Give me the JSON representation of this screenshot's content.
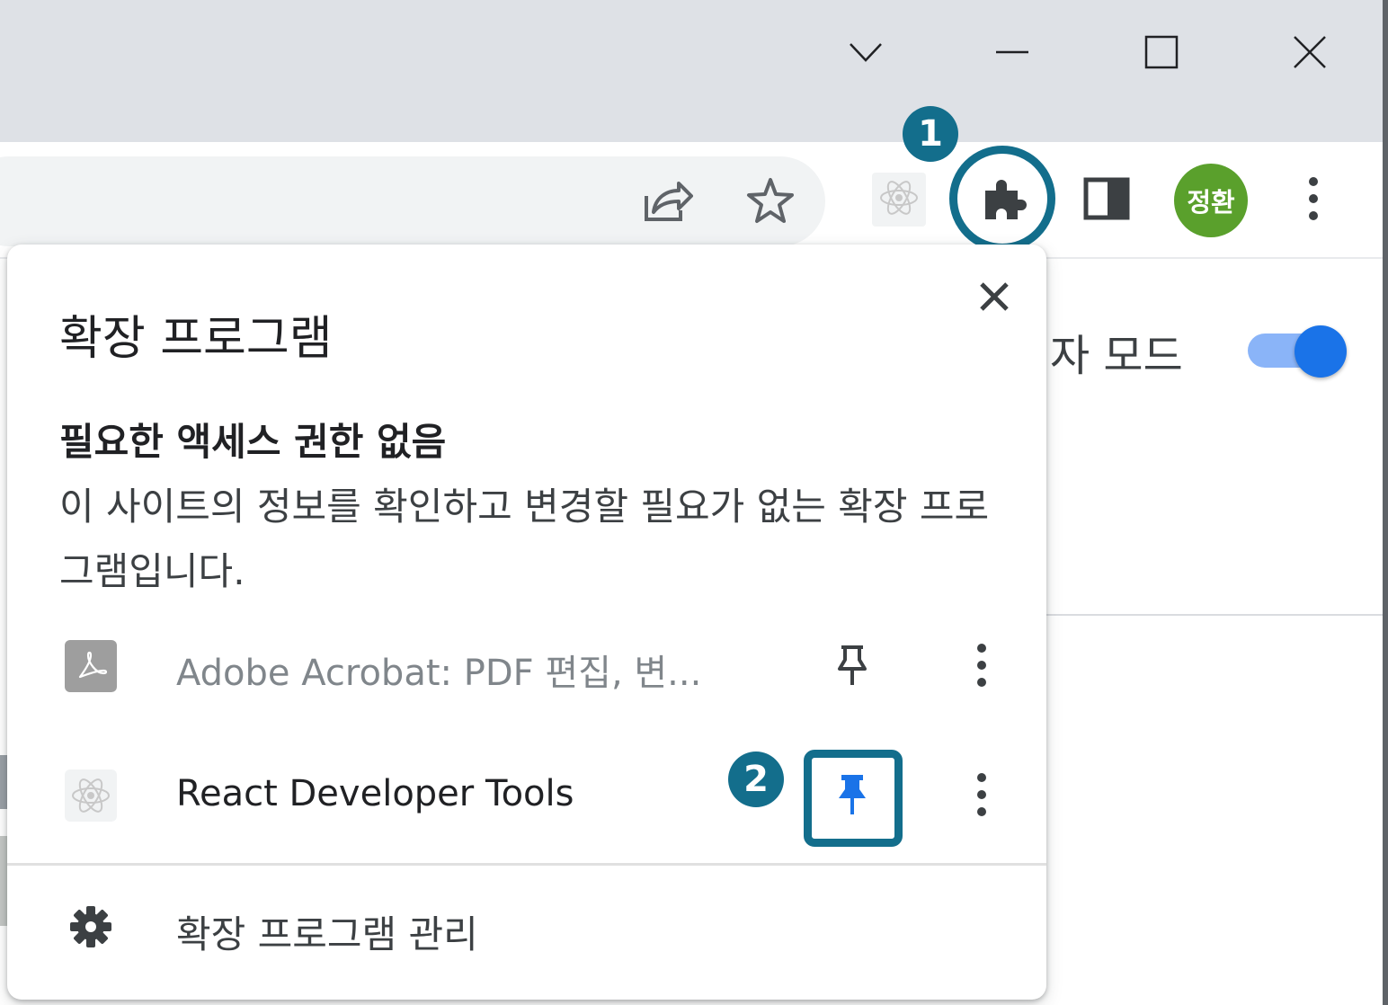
{
  "window_controls": {
    "tab_search_icon": "chevron-down",
    "minimize_icon": "minimize",
    "maximize_icon": "maximize",
    "close_icon": "close"
  },
  "toolbar": {
    "share_icon": "share",
    "bookmark_icon": "star",
    "react_ext_icon": "react-atom",
    "extensions_icon": "puzzle",
    "side_panel_icon": "side-panel",
    "profile_avatar": "정환",
    "menu_icon": "more-vertical"
  },
  "annotations": {
    "badge_1": "1",
    "badge_2": "2",
    "highlight_color": "#136e8c"
  },
  "background_page": {
    "setting_label": "자 모드",
    "toggle_on": true
  },
  "popup": {
    "title": "확장 프로그램",
    "section_heading": "필요한 액세스 권한 없음",
    "section_description": "이 사이트의 정보를 확인하고 변경할 필요가 없는 확장 프로그램입니다.",
    "extensions": [
      {
        "name": "Adobe Acrobat: PDF 편집, 변...",
        "icon": "adobe-acrobat",
        "pinned": false
      },
      {
        "name": "React Developer Tools",
        "icon": "react-atom",
        "pinned": true
      }
    ],
    "manage_label": "확장 프로그램 관리"
  },
  "colors": {
    "accent_blue": "#1a73e8",
    "avatar_green": "#5aa02c"
  }
}
